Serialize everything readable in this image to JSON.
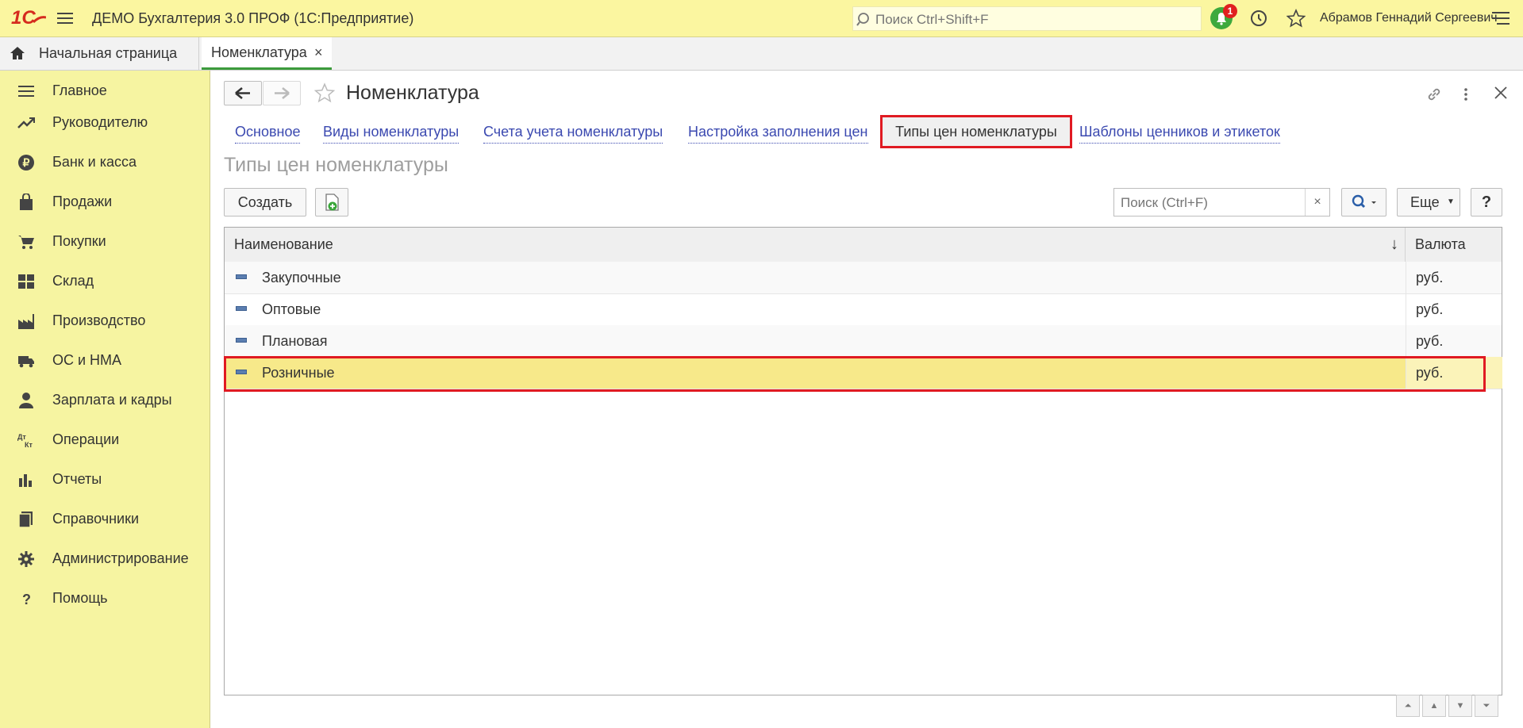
{
  "app": {
    "title": "ДЕМО Бухгалтерия 3.0 ПРОФ  (1С:Предприятие)",
    "logo_text": "1С",
    "search_placeholder": "Поиск Ctrl+Shift+F",
    "notifications_count": "1",
    "user_name": "Абрамов Геннадий Сергеевич"
  },
  "tabs": [
    {
      "label": "Начальная страница"
    },
    {
      "label": "Номенклатура",
      "close": "×"
    }
  ],
  "sidebar": {
    "items": [
      {
        "label": "Главное",
        "icon": "menu-lines-icon"
      },
      {
        "label": "Руководителю",
        "icon": "trend-chart-icon"
      },
      {
        "label": "Банк и касса",
        "icon": "ruble-coin-icon"
      },
      {
        "label": "Продажи",
        "icon": "shopping-bag-icon"
      },
      {
        "label": "Покупки",
        "icon": "cart-icon"
      },
      {
        "label": "Склад",
        "icon": "warehouse-grid-icon"
      },
      {
        "label": "Производство",
        "icon": "factory-icon"
      },
      {
        "label": "ОС и НМА",
        "icon": "truck-icon"
      },
      {
        "label": "Зарплата и кадры",
        "icon": "person-icon"
      },
      {
        "label": "Операции",
        "icon": "debit-credit-icon"
      },
      {
        "label": "Отчеты",
        "icon": "bar-chart-icon"
      },
      {
        "label": "Справочники",
        "icon": "books-icon"
      },
      {
        "label": "Администрирование",
        "icon": "gear-icon"
      },
      {
        "label": "Помощь",
        "icon": "question-icon"
      }
    ]
  },
  "form": {
    "title": "Номенклатура",
    "nav_links": [
      {
        "label": "Основное"
      },
      {
        "label": "Виды номенклатуры"
      },
      {
        "label": "Счета учета номенклатуры"
      },
      {
        "label": "Настройка заполнения цен"
      },
      {
        "label": "Типы цен номенклатуры",
        "active": true
      },
      {
        "label": "Шаблоны ценников и этикеток"
      }
    ],
    "section_title": "Типы цен номенклатуры",
    "create_label": "Создать",
    "search_placeholder": "Поиск (Ctrl+F)",
    "clear_label": "×",
    "more_label": "Еще",
    "help_label": "?"
  },
  "table": {
    "columns": [
      "Наименование",
      "Валюта"
    ],
    "sort_indicator": "↓",
    "rows": [
      {
        "name": "Закупочные",
        "currency": "руб."
      },
      {
        "name": "Оптовые",
        "currency": "руб."
      },
      {
        "name": "Плановая",
        "currency": "руб."
      },
      {
        "name": "Розничные",
        "currency": "руб.",
        "selected": true
      }
    ]
  },
  "colors": {
    "topbar": "#fbf6a0",
    "sidebar": "#f6f4a1",
    "selected_row": "#f7e98a",
    "highlight_outline": "#e01a22",
    "link": "#3b49b0",
    "active_tab_underline": "#3c9b3c"
  }
}
